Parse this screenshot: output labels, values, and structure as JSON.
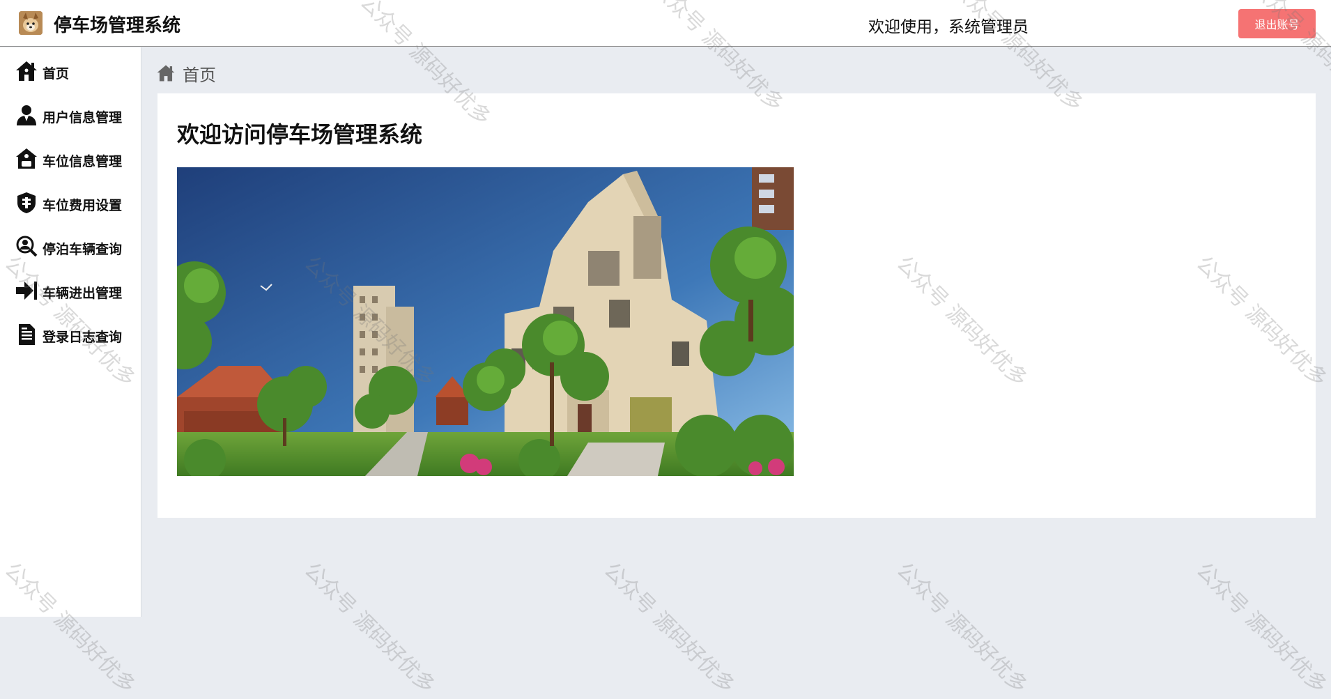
{
  "header": {
    "app_title": "停车场管理系统",
    "welcome_text": "欢迎使用，系统管理员",
    "logout_label": "退出账号",
    "logo_icon": "avatar-dog-icon"
  },
  "sidebar": {
    "items": [
      {
        "label": "首页",
        "icon": "home-icon"
      },
      {
        "label": "用户信息管理",
        "icon": "user-icon"
      },
      {
        "label": "车位信息管理",
        "icon": "garage-icon"
      },
      {
        "label": "车位费用设置",
        "icon": "fee-shield-icon"
      },
      {
        "label": "停泊车辆查询",
        "icon": "search-user-icon"
      },
      {
        "label": "车辆进出管理",
        "icon": "enter-arrow-icon"
      },
      {
        "label": "登录日志查询",
        "icon": "document-icon"
      }
    ]
  },
  "breadcrumb": {
    "label": "首页",
    "icon": "home-icon"
  },
  "main": {
    "welcome_title": "欢迎访问停车场管理系统",
    "hero_image": "building-illustration"
  },
  "watermark": {
    "text": "公众号 源码好优多"
  },
  "colors": {
    "logout_button": "#f56c6c",
    "page_background": "#e9ecf1",
    "card_background": "#ffffff"
  }
}
